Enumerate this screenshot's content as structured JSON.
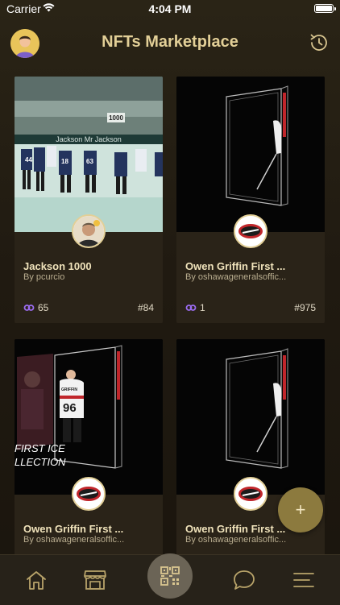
{
  "status_bar": {
    "carrier": "Carrier",
    "time": "4:04 PM"
  },
  "header": {
    "title": "NFTs Marketplace",
    "avatar_icon": "user-avatar",
    "history_icon": "clock-icon"
  },
  "colors": {
    "accent": "#e2cf97",
    "background": "#201a11",
    "fab": "#8c7a3e",
    "likes_icon": "#9b6cf0"
  },
  "cards": [
    {
      "title": "Jackson 1000",
      "creator": "By pcurcio",
      "likes": "65",
      "number": "#84"
    },
    {
      "title": "Owen Griffin First ...",
      "creator": "By oshawageneralsoffic...",
      "likes": "1",
      "number": "#975"
    },
    {
      "title": "Owen Griffin First ...",
      "creator": "By oshawageneralsoffic..."
    },
    {
      "title": "Owen Griffin First ...",
      "creator": "By oshawageneralsoffic..."
    }
  ],
  "card_art": {
    "jersey_number": "96",
    "jersey_name": "GRIFFIN",
    "collection_text_1": "FIRST ICE",
    "collection_text_2": "LLECTION",
    "banner_number": "1000",
    "banner_text": "Jackson Mr Jackson",
    "player_numbers": [
      "44",
      "18",
      "63"
    ]
  },
  "fab": {
    "label": "+"
  },
  "tabs": [
    "home",
    "store",
    "scan",
    "chat",
    "menu"
  ]
}
